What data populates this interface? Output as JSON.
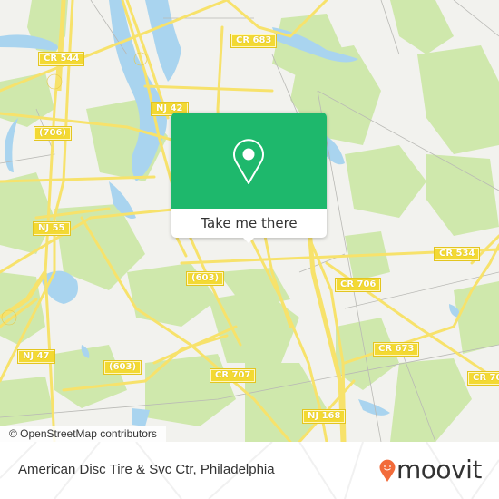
{
  "map": {
    "colors": {
      "background": "#f2f2ee",
      "woodland": "#cfe8ac",
      "water": "#a9d4ef",
      "road_major": "#f7e26b",
      "road_minor": "#b9b9b5",
      "shield_fill": "#f3d933"
    },
    "road_labels": [
      {
        "id": "cr-544",
        "text": "CR 544"
      },
      {
        "id": "cr-683",
        "text": "CR 683"
      },
      {
        "id": "nj-42",
        "text": "NJ 42"
      },
      {
        "id": "706-west",
        "text": "(706)"
      },
      {
        "id": "nj-55",
        "text": "NJ 55"
      },
      {
        "id": "603-north",
        "text": "(603)"
      },
      {
        "id": "cr-534",
        "text": "CR 534"
      },
      {
        "id": "cr-706",
        "text": "CR 706"
      },
      {
        "id": "nj-47",
        "text": "NJ 47"
      },
      {
        "id": "603-south",
        "text": "(603)"
      },
      {
        "id": "cr-707-west",
        "text": "CR 707"
      },
      {
        "id": "cr-673",
        "text": "CR 673"
      },
      {
        "id": "cr-707-east",
        "text": "CR 70"
      },
      {
        "id": "nj-168",
        "text": "NJ 168"
      }
    ],
    "attribution": "© OpenStreetMap contributors"
  },
  "popup": {
    "icon": "location-pin-icon",
    "button_label": "Take me there",
    "accent": "#1eb86c"
  },
  "footer": {
    "place_name": "American Disc Tire & Svc Ctr, Philadelphia",
    "brand": "moovit",
    "brand_icon": "moovit-pin-icon",
    "brand_color": "#f26b3a"
  }
}
